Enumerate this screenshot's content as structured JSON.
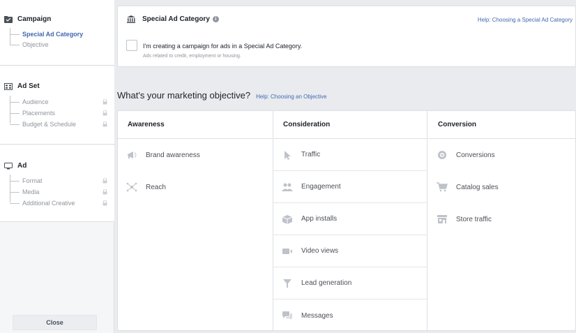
{
  "sidebar": {
    "campaign": {
      "title": "Campaign",
      "items": [
        {
          "label": "Special Ad Category"
        },
        {
          "label": "Objective"
        }
      ]
    },
    "ad_set": {
      "title": "Ad Set",
      "items": [
        {
          "label": "Audience"
        },
        {
          "label": "Placements"
        },
        {
          "label": "Budget & Schedule"
        }
      ]
    },
    "ad": {
      "title": "Ad",
      "items": [
        {
          "label": "Format"
        },
        {
          "label": "Media"
        },
        {
          "label": "Additional Creative"
        }
      ]
    },
    "close_label": "Close"
  },
  "special_ad": {
    "title": "Special Ad Category",
    "help_link": "Help: Choosing a Special Ad Category",
    "checkbox_label": "I'm creating a campaign for ads in a Special Ad Category.",
    "checkbox_sub": "Ads related to credit, employment or housing."
  },
  "objective": {
    "title": "What's your marketing objective?",
    "help_link": "Help: Choosing an Objective",
    "columns": [
      {
        "heading": "Awareness",
        "items": [
          {
            "label": "Brand awareness",
            "icon": "megaphone-icon"
          },
          {
            "label": "Reach",
            "icon": "reach-icon"
          }
        ]
      },
      {
        "heading": "Consideration",
        "items": [
          {
            "label": "Traffic",
            "icon": "cursor-icon"
          },
          {
            "label": "Engagement",
            "icon": "people-icon"
          },
          {
            "label": "App installs",
            "icon": "box-icon"
          },
          {
            "label": "Video views",
            "icon": "video-icon"
          },
          {
            "label": "Lead generation",
            "icon": "funnel-icon"
          },
          {
            "label": "Messages",
            "icon": "chat-icon"
          }
        ]
      },
      {
        "heading": "Conversion",
        "items": [
          {
            "label": "Conversions",
            "icon": "globe-icon"
          },
          {
            "label": "Catalog sales",
            "icon": "cart-icon"
          },
          {
            "label": "Store traffic",
            "icon": "store-icon"
          }
        ]
      }
    ]
  },
  "colors": {
    "accent": "#4267b2",
    "muted": "#90949c",
    "border": "#dddfe2"
  }
}
